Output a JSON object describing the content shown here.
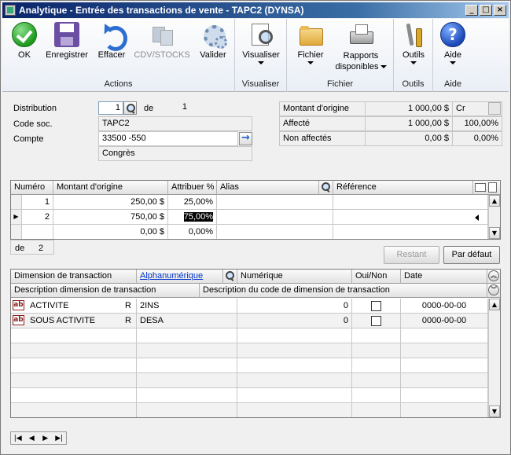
{
  "window": {
    "title": "Analytique - Entrée des transactions de vente  -  TAPC2 (DYNSA)",
    "controls": {
      "minimize": "_",
      "maximize": "□",
      "close": "×"
    }
  },
  "ribbon": {
    "groups": {
      "actions": "Actions",
      "visualiser": "Visualiser",
      "fichier": "Fichier",
      "outils": "Outils",
      "aide": "Aide"
    },
    "buttons": {
      "ok": "OK",
      "save": "Enregistrer",
      "clear": "Effacer",
      "cdv": "CDV/STOCKS",
      "validate": "Valider",
      "view": "Visualiser",
      "file": "Fichier",
      "reports_line1": "Rapports",
      "reports_line2": "disponibles",
      "tools": "Outils",
      "help": "Aide",
      "help_glyph": "?"
    },
    "icons": [
      "ok-icon",
      "save-icon",
      "undo-icon",
      "cdv-icon",
      "gear-icon",
      "view-icon",
      "folder-icon",
      "printer-icon",
      "tools-icon",
      "help-icon"
    ]
  },
  "header": {
    "distribution_label": "Distribution",
    "distribution_value": "1",
    "de_label": "de",
    "distribution_total": "1",
    "code_soc_label": "Code soc.",
    "code_soc_value": "TAPC2",
    "compte_label": "Compte",
    "compte_value": "33500 -550",
    "compte_desc": "Congrès",
    "compte_arrow": "→"
  },
  "amounts": {
    "origin_label": "Montant d'origine",
    "origin_value": "1 000,00 $",
    "origin_type": "Cr",
    "affecte_label": "Affecté",
    "affecte_value": "1 000,00 $",
    "affecte_pct": "100,00%",
    "non_affectes_label": "Non affectés",
    "non_affectes_value": "0,00 $",
    "non_affectes_pct": "0,00%"
  },
  "alloc_grid": {
    "headers": {
      "numero": "Numéro",
      "montant": "Montant d'origine",
      "attribuer": "Attribuer %",
      "alias": "Alias",
      "reference": "Référence"
    },
    "rows": [
      {
        "marker": "",
        "numero": "1",
        "montant": "250,00 $",
        "pct": "25,00%",
        "alias": "",
        "reference": ""
      },
      {
        "marker": "▶",
        "numero": "2",
        "montant": "750,00 $",
        "pct": "75,00%",
        "alias": "",
        "reference": ""
      },
      {
        "marker": "",
        "numero": "",
        "montant": "0,00 $",
        "pct": "0,00%",
        "alias": "",
        "reference": ""
      }
    ],
    "footer_de": "de",
    "footer_count": "2"
  },
  "buttons": {
    "restant": "Restant",
    "par_defaut": "Par défaut"
  },
  "dim_grid": {
    "headers": {
      "dimension": "Dimension de transaction",
      "alphanumerique": "Alphanumérique",
      "numerique": "Numérique",
      "oui_non": "Oui/Non",
      "date": "Date",
      "desc_dimension": "Description dimension de transaction",
      "desc_code": "Description du code de dimension de transaction"
    },
    "rows": [
      {
        "icon": "ab",
        "dimension": "ACTIVITE",
        "flag": "R",
        "alpha": "2INS",
        "numerique": "0",
        "date": "0000-00-00"
      },
      {
        "icon": "ab",
        "dimension": "SOUS ACTIVITE",
        "flag": "R",
        "alpha": "DESA",
        "numerique": "0",
        "date": "0000-00-00"
      }
    ]
  },
  "nav": {
    "first": "|◀",
    "prev": "◀",
    "next": "▶",
    "last": "▶|"
  }
}
